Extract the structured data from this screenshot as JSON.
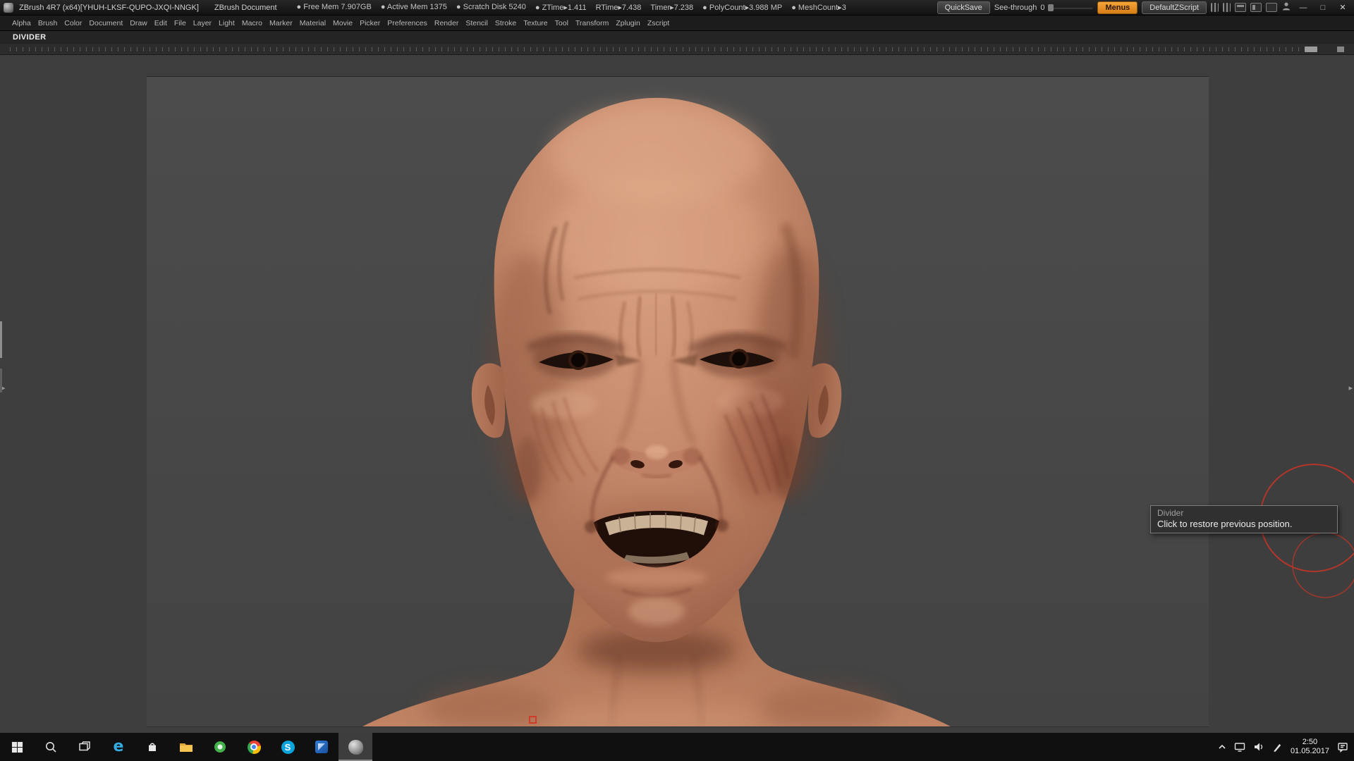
{
  "colors": {
    "accent_orange": "#ed8f2b",
    "skin": "#c68a6d",
    "cursor_red": "#c2392b"
  },
  "title_bar": {
    "app_title": "ZBrush 4R7 (x64)[YHUH-LKSF-QUPO-JXQI-NNGK]",
    "document_title": "ZBrush Document",
    "stats": [
      "● Free Mem 7.907GB",
      "● Active Mem 1375",
      "● Scratch Disk 5240",
      "● ZTime▸1.411",
      "RTime▸7.438",
      "Timer▸7.238",
      "● PolyCount▸3.988 MP",
      "● MeshCount▸3"
    ],
    "quicksave": "QuickSave",
    "see_through_label": "See-through",
    "see_through_value": "0",
    "menus": "Menus",
    "default_zscript": "DefaultZScript",
    "minimize": "—",
    "maximize": "□",
    "close": "✕"
  },
  "menu_bar": {
    "items": [
      "Alpha",
      "Brush",
      "Color",
      "Document",
      "Draw",
      "Edit",
      "File",
      "Layer",
      "Light",
      "Macro",
      "Marker",
      "Material",
      "Movie",
      "Picker",
      "Preferences",
      "Render",
      "Stencil",
      "Stroke",
      "Texture",
      "Tool",
      "Transform",
      "Zplugin",
      "Zscript"
    ]
  },
  "divider_panel": {
    "label": "DIVIDER"
  },
  "tooltip": {
    "title": "Divider",
    "message": "Click to restore previous position."
  },
  "taskbar": {
    "time": "2:50",
    "date": "01.05.2017",
    "edge_letter": "e",
    "skype_letter": "S"
  }
}
